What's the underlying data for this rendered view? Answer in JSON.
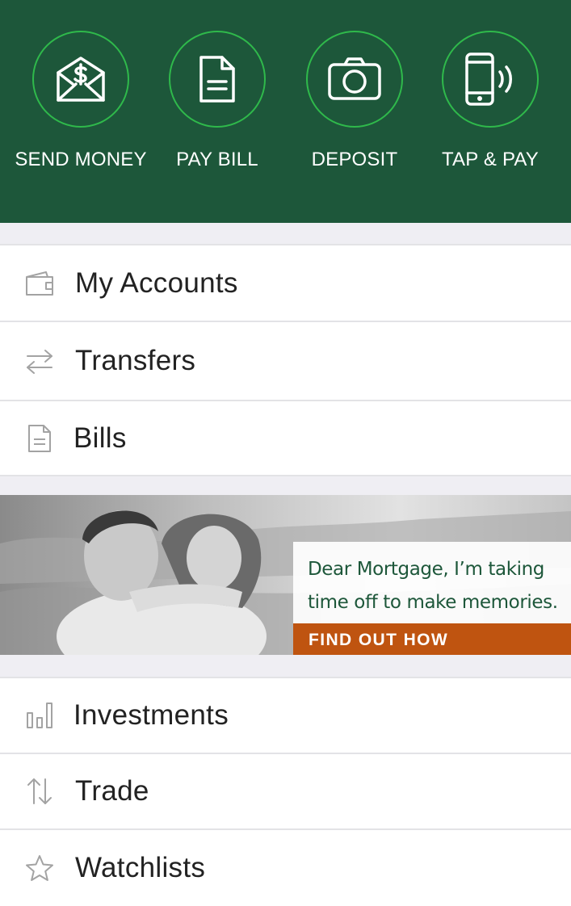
{
  "quick_actions": [
    {
      "label": "SEND MONEY",
      "icon": "send-money-icon"
    },
    {
      "label": "PAY BILL",
      "icon": "bill-icon"
    },
    {
      "label": "DEPOSIT",
      "icon": "camera-icon"
    },
    {
      "label": "TAP & PAY",
      "icon": "phone-tap-icon"
    }
  ],
  "menu_top": [
    {
      "label": "My Accounts",
      "icon": "wallet-icon"
    },
    {
      "label": "Transfers",
      "icon": "transfer-arrows-icon"
    },
    {
      "label": "Bills",
      "icon": "document-icon"
    }
  ],
  "banner": {
    "message": "Dear Mortgage, I’m taking time off to make memories.",
    "cta": "FIND OUT HOW"
  },
  "menu_bottom": [
    {
      "label": "Investments",
      "icon": "bar-chart-icon"
    },
    {
      "label": "Trade",
      "icon": "up-down-arrows-icon"
    },
    {
      "label": "Watchlists",
      "icon": "star-icon"
    }
  ],
  "colors": {
    "header": "#1d573a",
    "accent_ring": "#2fb94b",
    "cta": "#bf5410",
    "icon_gray": "#a3a3a3"
  }
}
